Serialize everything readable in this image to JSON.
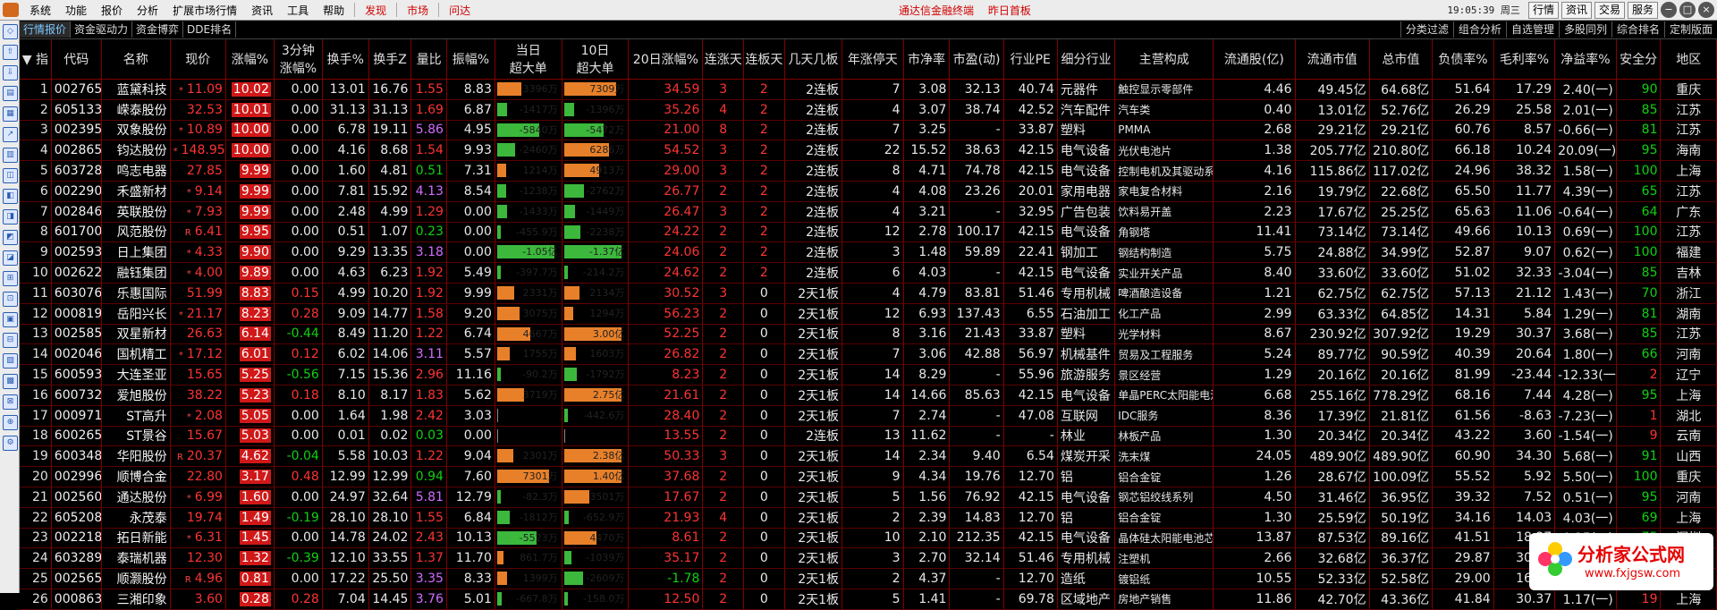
{
  "menu": [
    "系统",
    "功能",
    "报价",
    "分析",
    "扩展市场行情",
    "资讯",
    "工具",
    "帮助"
  ],
  "menu_red": [
    "发现",
    "市场",
    "问达"
  ],
  "notices": [
    "通达信金融终端",
    "昨日首板"
  ],
  "clock": "19:05:39 周三",
  "right_buttons": [
    "行情",
    "资讯",
    "交易",
    "服务"
  ],
  "window_buttons": [
    "−",
    "□",
    "×"
  ],
  "tabs": [
    "行情报价",
    "资金驱动力",
    "资金博弈",
    "DDE排名"
  ],
  "right_tabs": [
    "分类过滤",
    "组合分析",
    "自选管理",
    "多股同列",
    "综合排名",
    "定制版面"
  ],
  "columns": [
    "指",
    "代码",
    "名称",
    "现价",
    "涨幅%",
    "3分钟涨幅%",
    "换手%",
    "换手Z",
    "量比",
    "振幅%",
    "当日超大单",
    "10日超大单",
    "20日涨幅%",
    "连涨天",
    "连板天",
    "几天几板",
    "年涨停天",
    "市净率",
    "市盈(动)",
    "行业PE",
    "细分行业",
    "主营构成",
    "流通股(亿)",
    "流通市值",
    "总市值",
    "负债率%",
    "毛利率%",
    "净益率%",
    "安全分",
    "地区"
  ],
  "rows": [
    {
      "no": "1",
      "code": "002765",
      "name": "蓝黛科技",
      "mk": "*",
      "price": "11.09",
      "chg": "10.02",
      "m3": "0.00",
      "to": "13.01",
      "toz": "16.76",
      "vr": "1.55",
      "amp": "8.83",
      "d1": "3396万",
      "d1v": 3396,
      "d10": "7309万",
      "d10v": 7309,
      "r20": "34.59",
      "lz": "3",
      "lb": "2",
      "jt": "2连板",
      "nz": "7",
      "pb": "3.08",
      "pe": "32.13",
      "ipe": "40.74",
      "ind": "元器件",
      "biz": "触控显示零部件",
      "fs": "4.46",
      "fmv": "49.45亿",
      "tmv": "64.68亿",
      "debt": "51.64",
      "gm": "17.29",
      "nm": "2.40(一)",
      "safe": "90",
      "reg": "重庆"
    },
    {
      "no": "2",
      "code": "605133",
      "name": "嵘泰股份",
      "mk": "",
      "price": "32.53",
      "chg": "10.01",
      "m3": "0.00",
      "to": "31.13",
      "toz": "31.13",
      "vr": "1.69",
      "amp": "6.87",
      "d1": "-1417万",
      "d1v": -1417,
      "d10": "-1396万",
      "d10v": -1396,
      "r20": "35.26",
      "lz": "4",
      "lb": "2",
      "jt": "2连板",
      "nz": "4",
      "pb": "3.07",
      "pe": "38.74",
      "ipe": "42.52",
      "ind": "汽车配件",
      "biz": "汽车类",
      "fs": "0.40",
      "fmv": "13.01亿",
      "tmv": "52.76亿",
      "debt": "26.29",
      "gm": "25.58",
      "nm": "2.01(一)",
      "safe": "85",
      "reg": "江苏"
    },
    {
      "no": "3",
      "code": "002395",
      "name": "双象股份",
      "mk": "*",
      "price": "10.89",
      "chg": "10.00",
      "m3": "0.00",
      "to": "6.78",
      "toz": "19.11",
      "vr": "5.86",
      "amp": "4.95",
      "d1": "-5840万",
      "d1v": -5840,
      "d10": "-5472万",
      "d10v": -5472,
      "r20": "21.00",
      "lz": "8",
      "lb": "2",
      "jt": "2连板",
      "nz": "7",
      "pb": "3.25",
      "pe": "-",
      "ipe": "33.87",
      "ind": "塑料",
      "biz": "PMMA",
      "fs": "2.68",
      "fmv": "29.21亿",
      "tmv": "29.21亿",
      "debt": "60.76",
      "gm": "8.57",
      "nm": "-0.66(一)",
      "safe": "81",
      "reg": "江苏"
    },
    {
      "no": "4",
      "code": "002865",
      "name": "钧达股份",
      "mk": "*",
      "price": "148.95",
      "chg": "10.00",
      "m3": "0.00",
      "to": "4.16",
      "toz": "8.68",
      "vr": "1.54",
      "amp": "9.93",
      "d1": "-2460万",
      "d1v": -2460,
      "d10": "6286万",
      "d10v": 6286,
      "r20": "54.52",
      "lz": "3",
      "lb": "2",
      "jt": "2连板",
      "nz": "22",
      "pb": "15.52",
      "pe": "38.63",
      "ipe": "42.15",
      "ind": "电气设备",
      "biz": "光伏电池片",
      "fs": "1.38",
      "fmv": "205.77亿",
      "tmv": "210.80亿",
      "debt": "66.18",
      "gm": "10.24",
      "nm": "20.09(一)",
      "safe": "95",
      "reg": "海南"
    },
    {
      "no": "5",
      "code": "603728",
      "name": "鸣志电器",
      "mk": "",
      "price": "27.85",
      "chg": "9.99",
      "m3": "0.00",
      "to": "1.60",
      "toz": "4.81",
      "vr": "0.51",
      "amp": "7.31",
      "d1": "1214万",
      "d1v": 1214,
      "d10": "4913万",
      "d10v": 4913,
      "r20": "29.00",
      "lz": "3",
      "lb": "2",
      "jt": "2连板",
      "nz": "8",
      "pb": "4.71",
      "pe": "74.78",
      "ipe": "42.15",
      "ind": "电气设备",
      "biz": "控制电机及其驱动系统",
      "fs": "4.16",
      "fmv": "115.86亿",
      "tmv": "117.02亿",
      "debt": "24.96",
      "gm": "38.32",
      "nm": "1.58(一)",
      "safe": "100",
      "reg": "上海"
    },
    {
      "no": "6",
      "code": "002290",
      "name": "禾盛新材",
      "mk": "*",
      "price": "9.14",
      "chg": "9.99",
      "m3": "0.00",
      "to": "7.81",
      "toz": "15.92",
      "vr": "4.13",
      "amp": "8.54",
      "d1": "-1238万",
      "d1v": -1238,
      "d10": "-2762万",
      "d10v": -2762,
      "r20": "26.77",
      "lz": "2",
      "lb": "2",
      "jt": "2连板",
      "nz": "4",
      "pb": "4.08",
      "pe": "23.26",
      "ipe": "20.01",
      "ind": "家用电器",
      "biz": "家电复合材料",
      "fs": "2.16",
      "fmv": "19.79亿",
      "tmv": "22.68亿",
      "debt": "65.50",
      "gm": "11.77",
      "nm": "4.39(一)",
      "safe": "65",
      "reg": "江苏"
    },
    {
      "no": "7",
      "code": "002846",
      "name": "英联股份",
      "mk": "*",
      "price": "7.93",
      "chg": "9.99",
      "m3": "0.00",
      "to": "2.48",
      "toz": "4.99",
      "vr": "1.29",
      "amp": "0.00",
      "d1": "-1433万",
      "d1v": -1433,
      "d10": "-1449万",
      "d10v": -1449,
      "r20": "26.47",
      "lz": "3",
      "lb": "2",
      "jt": "2连板",
      "nz": "4",
      "pb": "3.21",
      "pe": "-",
      "ipe": "32.95",
      "ind": "广告包装",
      "biz": "饮料易开盖",
      "fs": "2.23",
      "fmv": "17.67亿",
      "tmv": "25.25亿",
      "debt": "65.63",
      "gm": "11.06",
      "nm": "-0.64(一)",
      "safe": "64",
      "reg": "广东"
    },
    {
      "no": "8",
      "code": "601700",
      "name": "风范股份",
      "mk": "R",
      "price": "6.41",
      "chg": "9.95",
      "m3": "0.00",
      "to": "0.51",
      "toz": "1.07",
      "vr": "0.23",
      "amp": "0.00",
      "d1": "-455.9万",
      "d1v": -455.9,
      "d10": "-2238万",
      "d10v": -2238,
      "r20": "24.22",
      "lz": "2",
      "lb": "2",
      "jt": "2连板",
      "nz": "12",
      "pb": "2.78",
      "pe": "100.17",
      "ipe": "42.15",
      "ind": "电气设备",
      "biz": "角钢塔",
      "fs": "11.41",
      "fmv": "73.14亿",
      "tmv": "73.14亿",
      "debt": "49.66",
      "gm": "10.13",
      "nm": "0.69(一)",
      "safe": "100",
      "reg": "江苏"
    },
    {
      "no": "9",
      "code": "002593",
      "name": "日上集团",
      "mk": "*",
      "price": "4.33",
      "chg": "9.90",
      "m3": "0.00",
      "to": "9.29",
      "toz": "13.35",
      "vr": "3.18",
      "amp": "0.00",
      "d1": "-1.05亿",
      "d1v": -10500,
      "d10": "-1.37亿",
      "d10v": -13700,
      "r20": "24.06",
      "lz": "2",
      "lb": "2",
      "jt": "2连板",
      "nz": "3",
      "pb": "1.48",
      "pe": "59.89",
      "ipe": "22.41",
      "ind": "钢加工",
      "biz": "钢结构制造",
      "fs": "5.75",
      "fmv": "24.88亿",
      "tmv": "34.99亿",
      "debt": "52.87",
      "gm": "9.07",
      "nm": "0.62(一)",
      "safe": "100",
      "reg": "福建"
    },
    {
      "no": "10",
      "code": "002622",
      "name": "融钰集团",
      "mk": "*",
      "price": "4.00",
      "chg": "9.89",
      "m3": "0.00",
      "to": "4.63",
      "toz": "6.23",
      "vr": "1.92",
      "amp": "5.49",
      "d1": "-397.7万",
      "d1v": -397.7,
      "d10": "-214.2万",
      "d10v": -214.2,
      "r20": "24.62",
      "lz": "2",
      "lb": "2",
      "jt": "2连板",
      "nz": "6",
      "pb": "4.03",
      "pe": "-",
      "ipe": "42.15",
      "ind": "电气设备",
      "biz": "实业开关产品",
      "fs": "8.40",
      "fmv": "33.60亿",
      "tmv": "33.60亿",
      "debt": "51.02",
      "gm": "32.33",
      "nm": "-3.04(一)",
      "safe": "85",
      "reg": "吉林"
    },
    {
      "no": "11",
      "code": "603076",
      "name": "乐惠国际",
      "mk": "",
      "price": "51.99",
      "chg": "8.83",
      "m3": "0.15",
      "to": "4.99",
      "toz": "10.20",
      "vr": "1.92",
      "amp": "9.99",
      "d1": "2331万",
      "d1v": 2331,
      "d10": "2134万",
      "d10v": 2134,
      "r20": "30.52",
      "lz": "3",
      "lb": "0",
      "jt": "2天1板",
      "nz": "4",
      "pb": "4.79",
      "pe": "83.81",
      "ipe": "51.46",
      "ind": "专用机械",
      "biz": "啤酒酿造设备",
      "fs": "1.21",
      "fmv": "62.75亿",
      "tmv": "62.75亿",
      "debt": "57.13",
      "gm": "21.12",
      "nm": "1.43(一)",
      "safe": "70",
      "reg": "浙江"
    },
    {
      "no": "12",
      "code": "000819",
      "name": "岳阳兴长",
      "mk": "*",
      "price": "21.17",
      "chg": "8.23",
      "m3": "0.28",
      "to": "9.09",
      "toz": "14.77",
      "vr": "1.58",
      "amp": "9.20",
      "d1": "3075万",
      "d1v": 3075,
      "d10": "1294万",
      "d10v": 1294,
      "r20": "56.23",
      "lz": "2",
      "lb": "0",
      "jt": "2天1板",
      "nz": "12",
      "pb": "6.93",
      "pe": "137.43",
      "ipe": "6.55",
      "ind": "石油加工",
      "biz": "化工产品",
      "fs": "2.99",
      "fmv": "63.33亿",
      "tmv": "64.85亿",
      "debt": "14.31",
      "gm": "5.84",
      "nm": "1.29(一)",
      "safe": "81",
      "reg": "湖南"
    },
    {
      "no": "13",
      "code": "002585",
      "name": "双星新材",
      "mk": "",
      "price": "26.63",
      "chg": "6.14",
      "m3": "-0.44",
      "to": "8.49",
      "toz": "11.20",
      "vr": "1.22",
      "amp": "6.74",
      "d1": "4667万",
      "d1v": 4667,
      "d10": "3.00亿",
      "d10v": 30000,
      "r20": "52.25",
      "lz": "2",
      "lb": "0",
      "jt": "2天1板",
      "nz": "8",
      "pb": "3.16",
      "pe": "21.43",
      "ipe": "33.87",
      "ind": "塑料",
      "biz": "光学材料",
      "fs": "8.67",
      "fmv": "230.92亿",
      "tmv": "307.92亿",
      "debt": "19.29",
      "gm": "30.37",
      "nm": "3.68(一)",
      "safe": "85",
      "reg": "江苏"
    },
    {
      "no": "14",
      "code": "002046",
      "name": "国机精工",
      "mk": "*",
      "price": "17.12",
      "chg": "6.01",
      "m3": "0.12",
      "to": "6.02",
      "toz": "14.06",
      "vr": "3.11",
      "amp": "5.57",
      "d1": "1755万",
      "d1v": 1755,
      "d10": "1603万",
      "d10v": 1603,
      "r20": "26.82",
      "lz": "2",
      "lb": "0",
      "jt": "2天1板",
      "nz": "7",
      "pb": "3.06",
      "pe": "42.88",
      "ipe": "56.97",
      "ind": "机械基件",
      "biz": "贸易及工程服务",
      "fs": "5.24",
      "fmv": "89.77亿",
      "tmv": "90.59亿",
      "debt": "40.39",
      "gm": "20.64",
      "nm": "1.80(一)",
      "safe": "66",
      "reg": "河南"
    },
    {
      "no": "15",
      "code": "600593",
      "name": "大连圣亚",
      "mk": "",
      "price": "15.65",
      "chg": "5.25",
      "m3": "-0.56",
      "to": "7.15",
      "toz": "15.36",
      "vr": "2.96",
      "amp": "11.16",
      "d1": "-90.2万",
      "d1v": -90.2,
      "d10": "-1792万",
      "d10v": -1792,
      "r20": "8.23",
      "lz": "2",
      "lb": "0",
      "jt": "2天1板",
      "nz": "14",
      "pb": "8.29",
      "pe": "-",
      "ipe": "55.96",
      "ind": "旅游服务",
      "biz": "景区经营",
      "fs": "1.29",
      "fmv": "20.16亿",
      "tmv": "20.16亿",
      "debt": "81.99",
      "gm": "-23.44",
      "nm": "-12.33(一)",
      "safe": "2",
      "reg": "辽宁"
    },
    {
      "no": "16",
      "code": "600732",
      "name": "爱旭股份",
      "mk": "",
      "price": "38.22",
      "chg": "5.23",
      "m3": "0.18",
      "to": "8.10",
      "toz": "8.17",
      "vr": "1.83",
      "amp": "5.62",
      "d1": "3719万",
      "d1v": 3719,
      "d10": "2.75亿",
      "d10v": 27500,
      "r20": "21.61",
      "lz": "2",
      "lb": "0",
      "jt": "2天1板",
      "nz": "14",
      "pb": "14.66",
      "pe": "85.63",
      "ipe": "42.15",
      "ind": "电气设备",
      "biz": "单晶PERC太阳能电池",
      "fs": "6.68",
      "fmv": "255.16亿",
      "tmv": "778.29亿",
      "debt": "68.16",
      "gm": "7.44",
      "nm": "4.28(一)",
      "safe": "95",
      "reg": "上海"
    },
    {
      "no": "17",
      "code": "000971",
      "name": "ST高升",
      "mk": "*",
      "price": "2.08",
      "chg": "5.05",
      "m3": "0.00",
      "to": "1.64",
      "toz": "1.98",
      "vr": "2.42",
      "amp": "3.03",
      "d1": "",
      "d1v": 0,
      "d10": "-442.6万",
      "d10v": -442.6,
      "r20": "28.40",
      "lz": "2",
      "lb": "0",
      "jt": "2天1板",
      "nz": "7",
      "pb": "2.74",
      "pe": "-",
      "ipe": "47.08",
      "ind": "互联网",
      "biz": "IDC服务",
      "fs": "8.36",
      "fmv": "17.39亿",
      "tmv": "21.81亿",
      "debt": "61.56",
      "gm": "-8.63",
      "nm": "-7.23(一)",
      "safe": "1",
      "reg": "湖北"
    },
    {
      "no": "18",
      "code": "600265",
      "name": "ST景谷",
      "mk": "",
      "price": "15.67",
      "chg": "5.03",
      "m3": "0.00",
      "to": "0.01",
      "toz": "0.02",
      "vr": "0.03",
      "amp": "0.00",
      "d1": "",
      "d1v": 0,
      "d10": "",
      "d10v": 0,
      "r20": "13.55",
      "lz": "2",
      "lb": "0",
      "jt": "2连板",
      "nz": "13",
      "pb": "11.62",
      "pe": "-",
      "ipe": "-",
      "ind": "林业",
      "biz": "林板产品",
      "fs": "1.30",
      "fmv": "20.34亿",
      "tmv": "20.34亿",
      "debt": "43.22",
      "gm": "3.60",
      "nm": "-1.54(一)",
      "safe": "9",
      "reg": "云南"
    },
    {
      "no": "19",
      "code": "600348",
      "name": "华阳股份",
      "mk": "R",
      "price": "20.37",
      "chg": "4.62",
      "m3": "-0.04",
      "to": "5.58",
      "toz": "10.03",
      "vr": "1.22",
      "amp": "9.04",
      "d1": "2301万",
      "d1v": 2301,
      "d10": "2.38亿",
      "d10v": 23800,
      "r20": "50.33",
      "lz": "3",
      "lb": "0",
      "jt": "2天1板",
      "nz": "14",
      "pb": "2.34",
      "pe": "9.40",
      "ipe": "6.54",
      "ind": "煤炭开采",
      "biz": "洗末煤",
      "fs": "24.05",
      "fmv": "489.90亿",
      "tmv": "489.90亿",
      "debt": "60.90",
      "gm": "34.30",
      "nm": "5.68(一)",
      "safe": "91",
      "reg": "山西"
    },
    {
      "no": "20",
      "code": "002996",
      "name": "顺博合金",
      "mk": "",
      "price": "22.80",
      "chg": "3.17",
      "m3": "0.48",
      "to": "12.99",
      "toz": "12.99",
      "vr": "0.94",
      "amp": "7.60",
      "d1": "7301万",
      "d1v": 7301,
      "d10": "1.40亿",
      "d10v": 14000,
      "r20": "37.68",
      "lz": "2",
      "lb": "0",
      "jt": "2天1板",
      "nz": "9",
      "pb": "4.34",
      "pe": "19.76",
      "ipe": "12.70",
      "ind": "铝",
      "biz": "铝合金锭",
      "fs": "1.26",
      "fmv": "28.67亿",
      "tmv": "100.09亿",
      "debt": "55.52",
      "gm": "5.92",
      "nm": "5.50(一)",
      "safe": "100",
      "reg": "重庆"
    },
    {
      "no": "21",
      "code": "002560",
      "name": "通达股份",
      "mk": "*",
      "price": "6.99",
      "chg": "1.60",
      "m3": "0.00",
      "to": "24.97",
      "toz": "32.64",
      "vr": "5.81",
      "amp": "12.79",
      "d1": "-82.3万",
      "d1v": -82.3,
      "d10": "3501万",
      "d10v": 3501,
      "r20": "17.67",
      "lz": "2",
      "lb": "0",
      "jt": "2天1板",
      "nz": "5",
      "pb": "1.56",
      "pe": "76.92",
      "ipe": "42.15",
      "ind": "电气设备",
      "biz": "钢芯铝绞线系列",
      "fs": "4.50",
      "fmv": "31.46亿",
      "tmv": "36.95亿",
      "debt": "39.32",
      "gm": "7.52",
      "nm": "0.51(一)",
      "safe": "95",
      "reg": "河南"
    },
    {
      "no": "22",
      "code": "605208",
      "name": "永茂泰",
      "mk": "",
      "price": "19.74",
      "chg": "1.49",
      "m3": "-0.19",
      "to": "28.10",
      "toz": "28.10",
      "vr": "1.55",
      "amp": "6.84",
      "d1": "-1812万",
      "d1v": -1812,
      "d10": "-652.9万",
      "d10v": -652.9,
      "r20": "21.93",
      "lz": "4",
      "lb": "0",
      "jt": "2天1板",
      "nz": "2",
      "pb": "2.39",
      "pe": "14.83",
      "ipe": "12.70",
      "ind": "铝",
      "biz": "铝合金锭",
      "fs": "1.30",
      "fmv": "25.59亿",
      "tmv": "50.19亿",
      "debt": "34.16",
      "gm": "14.03",
      "nm": "4.03(一)",
      "safe": "69",
      "reg": "上海"
    },
    {
      "no": "23",
      "code": "002218",
      "name": "拓日新能",
      "mk": "*",
      "price": "6.31",
      "chg": "1.45",
      "m3": "0.00",
      "to": "14.78",
      "toz": "24.02",
      "vr": "2.43",
      "amp": "10.13",
      "d1": "-5523万",
      "d1v": -5523,
      "d10": "4470万",
      "d10v": 4470,
      "r20": "8.61",
      "lz": "2",
      "lb": "0",
      "jt": "2天1板",
      "nz": "10",
      "pb": "2.10",
      "pe": "212.35",
      "ipe": "42.15",
      "ind": "电气设备",
      "biz": "晶体硅太阳能电池芯片",
      "fs": "13.87",
      "fmv": "87.53亿",
      "tmv": "89.16亿",
      "debt": "41.51",
      "gm": "18.37",
      "nm": "0.25(一)",
      "safe": "75",
      "reg": "深圳"
    },
    {
      "no": "24",
      "code": "603289",
      "name": "泰瑞机器",
      "mk": "",
      "price": "12.30",
      "chg": "1.32",
      "m3": "-0.39",
      "to": "12.10",
      "toz": "33.55",
      "vr": "1.37",
      "amp": "11.70",
      "d1": "861.7万",
      "d1v": 861.7,
      "d10": "-1039万",
      "d10v": -1039,
      "r20": "35.17",
      "lz": "2",
      "lb": "0",
      "jt": "2天1板",
      "nz": "3",
      "pb": "2.70",
      "pe": "32.14",
      "ipe": "51.46",
      "ind": "专用机械",
      "biz": "注塑机",
      "fs": "2.66",
      "fmv": "32.68亿",
      "tmv": "36.37亿",
      "debt": "29.87",
      "gm": "30.39",
      "nm": "3.71(一)",
      "safe": "79",
      "reg": "浙江"
    },
    {
      "no": "25",
      "code": "002565",
      "name": "顺灏股份",
      "mk": "R",
      "price": "4.96",
      "chg": "0.81",
      "m3": "0.00",
      "to": "17.22",
      "toz": "25.50",
      "vr": "3.35",
      "amp": "8.33",
      "d1": "1399万",
      "d1v": 1399,
      "d10": "-2609万",
      "d10v": -2609,
      "r20": "-1.78",
      "lz": "2",
      "lb": "0",
      "jt": "2天1板",
      "nz": "2",
      "pb": "4.37",
      "pe": "-",
      "ipe": "12.70",
      "ind": "造纸",
      "biz": "镀铝纸",
      "fs": "10.55",
      "fmv": "52.33亿",
      "tmv": "52.58亿",
      "debt": "29.00",
      "gm": "16.04",
      "nm": "-1.33(一)",
      "safe": "40",
      "reg": "上海"
    },
    {
      "no": "26",
      "code": "000863",
      "name": "三湘印象",
      "mk": "",
      "price": "3.60",
      "chg": "0.28",
      "m3": "0.28",
      "to": "7.04",
      "toz": "14.45",
      "vr": "3.76",
      "amp": "5.01",
      "d1": "-667.8万",
      "d1v": -667.8,
      "d10": "-158.0万",
      "d10v": -158,
      "r20": "12.50",
      "lz": "2",
      "lb": "0",
      "jt": "2天1板",
      "nz": "5",
      "pb": "1.41",
      "pe": "-",
      "ipe": "69.78",
      "ind": "区域地产",
      "biz": "房地产销售",
      "fs": "11.86",
      "fmv": "42.70亿",
      "tmv": "43.36亿",
      "debt": "41.84",
      "gm": "30.37",
      "nm": "1.17(一)",
      "safe": "19",
      "reg": "上海"
    }
  ],
  "watermark": {
    "title": "分析家公式网",
    "url": "www.fxjgsw.com"
  }
}
